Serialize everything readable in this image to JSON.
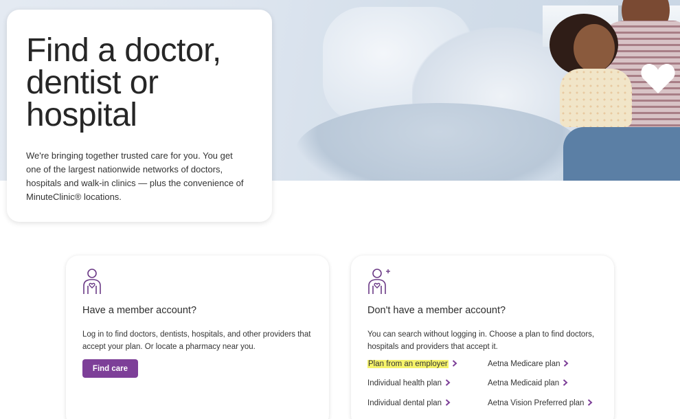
{
  "hero": {
    "title": "Find a doctor, dentist or hospital",
    "description": "We're bringing together trusted care for you. You get one of the largest nationwide networks of doctors, hospitals and walk-in clinics — plus the convenience of MinuteClinic® locations."
  },
  "member_card": {
    "icon": "person-heart-icon",
    "heading": "Have a member account?",
    "body": "Log in to find doctors, dentists, hospitals, and other providers that accept your plan. Or locate a pharmacy near you.",
    "button_label": "Find care"
  },
  "guest_card": {
    "icon": "person-heart-plus-icon",
    "heading": "Don't have a member account?",
    "body": "You can search without logging in. Choose a plan to find doctors, hospitals and providers that accept it.",
    "plans": [
      {
        "label": "Plan from an employer",
        "highlighted": true
      },
      {
        "label": "Aetna Medicare plan",
        "highlighted": false
      },
      {
        "label": "Individual health plan",
        "highlighted": false
      },
      {
        "label": "Aetna Medicaid plan",
        "highlighted": false
      },
      {
        "label": "Individual dental plan",
        "highlighted": false
      },
      {
        "label": "Aetna Vision Preferred plan",
        "highlighted": false
      }
    ]
  },
  "colors": {
    "brand_purple": "#7d3f98",
    "highlight": "#f5f36a"
  }
}
